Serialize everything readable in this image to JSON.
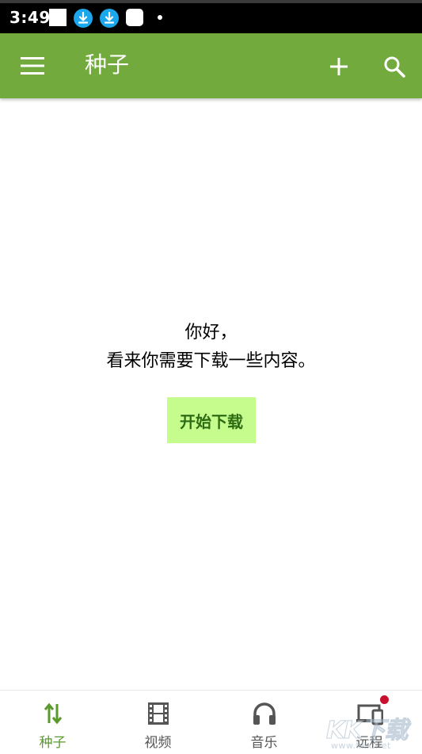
{
  "status_bar": {
    "time": "3:49",
    "icons": [
      "notification-square-icon",
      "download-icon",
      "download-icon",
      "app-notification-icon",
      "more-dot-icon"
    ],
    "download_icon_color": "#1aa7ec"
  },
  "app_bar": {
    "title": "种子",
    "background": "#72aa3d",
    "icons": [
      "menu-icon",
      "add-icon",
      "search-icon"
    ]
  },
  "empty_state": {
    "greeting": "你好，",
    "message": "看来你需要下载一些内容。",
    "button_label": "开始下载",
    "button_color": "#c6fb8d"
  },
  "bottom_nav": {
    "items": [
      {
        "label": "种子",
        "icon": "transfer-arrows-icon",
        "active": true
      },
      {
        "label": "视频",
        "icon": "film-icon",
        "active": false
      },
      {
        "label": "音乐",
        "icon": "headphones-icon",
        "active": false
      },
      {
        "label": "远程",
        "icon": "remote-devices-icon",
        "active": false
      }
    ],
    "active_color": "#5a9a2c",
    "badge_color": "#c8102e"
  },
  "watermark": {
    "main": "KK下载",
    "sub": "www.kkx.net"
  }
}
